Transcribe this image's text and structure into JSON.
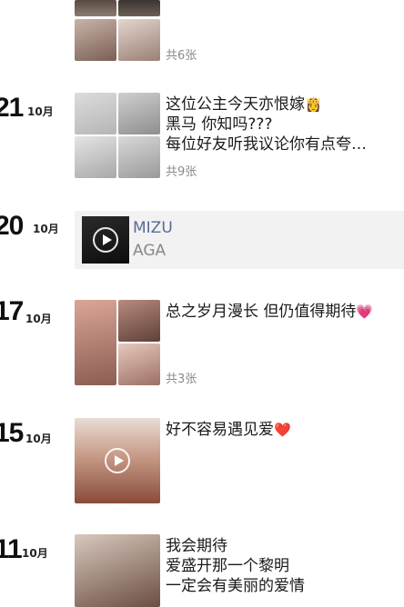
{
  "posts": [
    {
      "count": "共6张"
    },
    {
      "day": "21",
      "month": "10月",
      "lines": [
        "这位公主今天亦恨嫁",
        "黑马 你知吗???",
        "每位好友听我议论你有点夸…"
      ],
      "emoji": "👸",
      "count": "共9张"
    },
    {
      "day": "20",
      "month": "10月",
      "music": {
        "title": "MIZU",
        "artist": "AGA",
        "thumb_label": "MIZU"
      }
    },
    {
      "day": "17",
      "month": "10月",
      "lines": [
        "总之岁月漫长 但仍值得期待"
      ],
      "emoji": "💗",
      "count": "共3张"
    },
    {
      "day": "15",
      "month": "10月",
      "lines": [
        "好不容易遇见爱"
      ],
      "emoji": "❤️"
    },
    {
      "day": "11",
      "month": "10月",
      "lines": [
        "我会期待",
        "爱盛开那一个黎明",
        "一定会有美丽的爱情"
      ]
    }
  ],
  "colors": {
    "link": "#576b95",
    "muted": "#8a8a8a",
    "card": "#f2f2f2"
  }
}
